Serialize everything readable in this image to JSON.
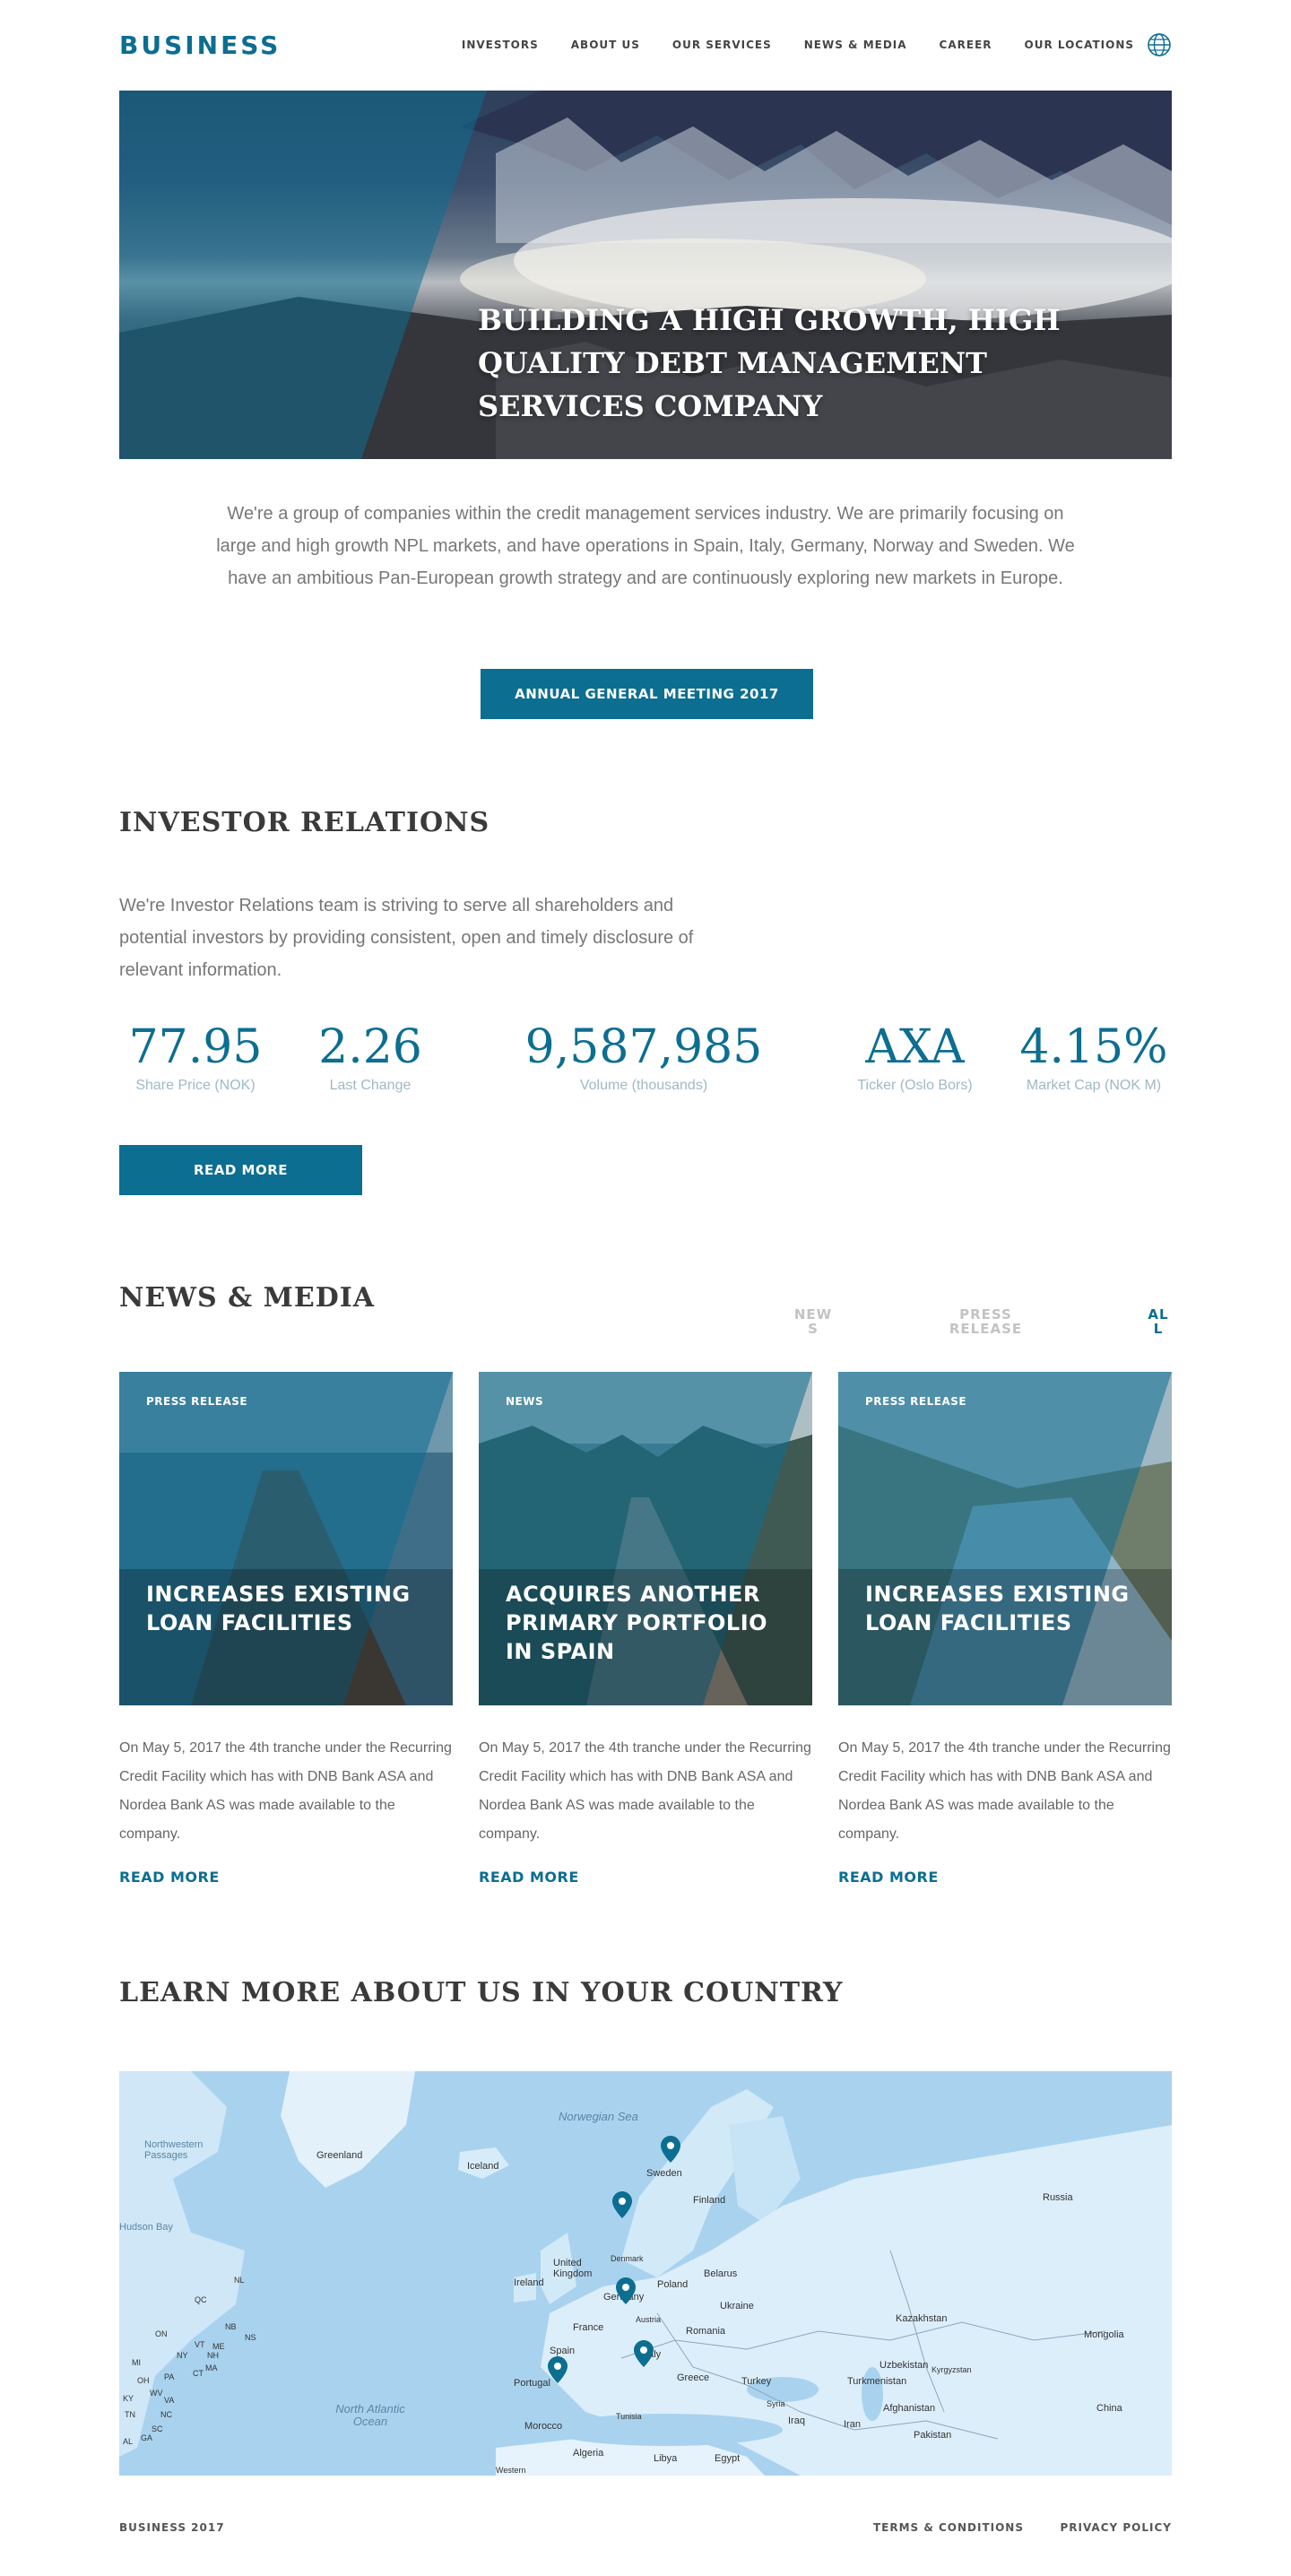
{
  "header": {
    "logo": "BUSINESS",
    "nav": [
      "INVESTORS",
      "ABOUT US",
      "OUR SERVICES",
      "NEWS & MEDIA",
      "CAREER",
      "OUR LOCATIONS"
    ],
    "globe_icon": "globe-icon"
  },
  "hero": {
    "title": "BUILDING A HIGH GROWTH, HIGH QUALITY DEBT MANAGEMENT SERVICES COMPANY"
  },
  "intro": {
    "text": "We're a group of companies within the credit management services industry. We are primarily focusing on large and high growth NPL markets, and have operations in Spain, Italy, Germany, Norway and Sweden. We have an ambitious Pan-European growth strategy and are continuously exploring new markets in Europe.",
    "button": "ANNUAL GENERAL MEETING 2017"
  },
  "investor": {
    "heading": "INVESTOR RELATIONS",
    "text": "We're Investor Relations team is striving to serve all shareholders and potential investors by providing consistent, open and timely disclosure of relevant information.",
    "stats": [
      {
        "value": "77.95",
        "label": "Share Price (NOK)"
      },
      {
        "value": "2.26",
        "label": "Last Change"
      },
      {
        "value": "9,587,985",
        "label": "Volume (thousands)"
      },
      {
        "value": "AXA",
        "label": "Ticker (Oslo Bors)"
      },
      {
        "value": "4.15%",
        "label": "Market Cap (NOK M)"
      }
    ],
    "button": "READ MORE"
  },
  "news": {
    "heading": "NEWS & MEDIA",
    "filters": {
      "news": "NEW S",
      "press": "PRESS RELEASE",
      "all": "AL L"
    },
    "cards": [
      {
        "tag": "PRESS RELEASE",
        "title": "INCREASES EXISTING LOAN FACILITIES",
        "text": "On May 5,  2017 the 4th tranche under the Recurring Credit Facility which has with DNB Bank ASA and Nordea Bank AS was made available to the company.",
        "more": "READ MORE"
      },
      {
        "tag": "NEWS",
        "title": "ACQUIRES ANOTHER PRIMARY PORTFOLIO IN SPAIN",
        "text": "On May 5,  2017 the 4th tranche under the Recurring Credit Facility which  has with DNB Bank ASA and Nordea Bank AS was made available to the company.",
        "more": "READ MORE"
      },
      {
        "tag": "PRESS RELEASE",
        "title": "INCREASES EXISTING LOAN FACILITIES",
        "text": "On May 5,  2017 the 4th tranche under the Recurring Credit Facility which  has with DNB Bank ASA and Nordea Bank AS was made available to the company.",
        "more": "READ MORE"
      }
    ]
  },
  "map_section": {
    "heading": "LEARN MORE ABOUT US IN YOUR COUNTRY",
    "labels": {
      "greenland": "Greenland",
      "iceland": "Iceland",
      "sweden": "Sweden",
      "finland": "Finland",
      "russia": "Russia",
      "denmark": "Denmark",
      "uk": "United Kingdom",
      "ireland": "Ireland",
      "poland": "Poland",
      "belarus": "Belarus",
      "germany": "Germany",
      "ukraine": "Ukraine",
      "austria": "Austria",
      "france": "France",
      "romania": "Romania",
      "kazakhstan": "Kazakhstan",
      "mongolia": "Mongolia",
      "spain": "Spain",
      "portugal": "Portugal",
      "italy": "Italy",
      "greece": "Greece",
      "turkey": "Turkey",
      "uzbekistan": "Uzbekistan",
      "kyrgyzstan": "Kyrgyzstan",
      "turkmenistan": "Turkmenistan",
      "afghanistan": "Afghanistan",
      "china": "China",
      "syria": "Syria",
      "iraq": "Iraq",
      "iran": "Iran",
      "pakistan": "Pakistan",
      "tunisia": "Tunisia",
      "morocco": "Morocco",
      "algeria": "Algeria",
      "libya": "Libya",
      "egypt": "Egypt",
      "western": "Western",
      "norwegian_sea": "Norwegian Sea",
      "north_atlantic": "North Atlantic Ocean",
      "nw_passages": "Northwestern Passages",
      "hudson_bay": "Hudson Bay",
      "qc": "QC",
      "nl": "NL",
      "on": "ON",
      "nb": "NB",
      "ns": "NS",
      "me": "ME",
      "vt": "VT",
      "nh": "NH",
      "ny": "NY",
      "ma": "MA",
      "ct": "CT",
      "mi": "MI",
      "oh": "OH",
      "pa": "PA",
      "wv": "WV",
      "va": "VA",
      "ky": "KY",
      "tn": "TN",
      "nc": "NC",
      "sc": "SC",
      "ga": "GA",
      "al": "AL"
    }
  },
  "footer": {
    "copy": "BUSINESS 2017",
    "terms": "TERMS & CONDITIONS",
    "privacy": "PRIVACY POLICY"
  }
}
